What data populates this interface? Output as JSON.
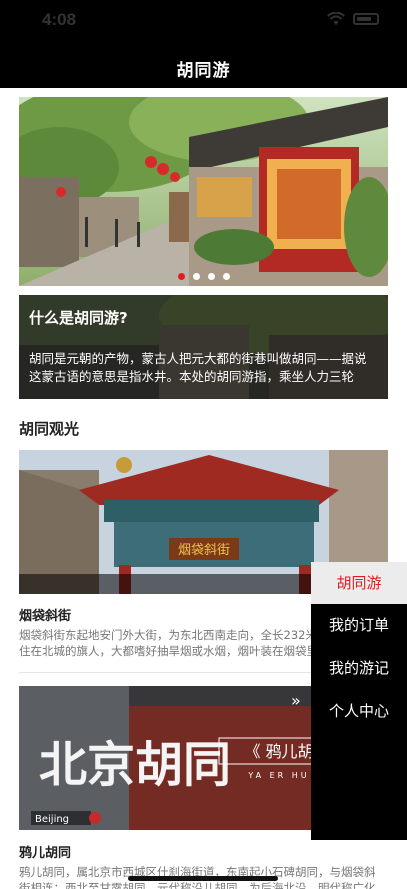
{
  "status_bar": {
    "time": "4:08"
  },
  "header": {
    "title": "胡同游"
  },
  "banner": {
    "dot_count": 4,
    "active_dot": 0
  },
  "intro": {
    "title": "什么是胡同游?",
    "text": "胡同是元朝的产物，蒙古人把元大都的街巷叫做胡同——据说这蒙古语的意思是指水井。本处的胡同游指，乘坐人力三轮车…"
  },
  "section": {
    "title": "胡同观光"
  },
  "spots": [
    {
      "name": "烟袋斜街",
      "sign_text": "烟袋斜街",
      "desc": "烟袋斜街东起地安门外大街，为东北西南走向，全长232米。清朝时居住在北城的旗人，大都嗜好抽旱烟或水烟，烟叶装在烟袋里，对烟袋的需求与日俱增，所以斜街上一户一户开起了烟袋铺。"
    },
    {
      "name": "鸦儿胡同",
      "sign_text": "鸦儿胡",
      "sign_sub": "YA ER HU",
      "calligraphy": "北京胡同",
      "desc": "鸦儿胡同，属北京市西城区什刹海街道，东南起小石碑胡同，与烟袋斜街相连；西北至甘露胡同。元代称沿儿胡同，为后海北沿，明代称广化寺街。"
    }
  ],
  "menu": {
    "items": [
      {
        "label": "胡同游",
        "active": true
      },
      {
        "label": "我的订单",
        "active": false
      },
      {
        "label": "我的游记",
        "active": false
      },
      {
        "label": "个人中心",
        "active": false
      }
    ]
  },
  "colors": {
    "accent": "#e21c1c",
    "header_bg": "#000000",
    "menu_bg": "#000000"
  }
}
